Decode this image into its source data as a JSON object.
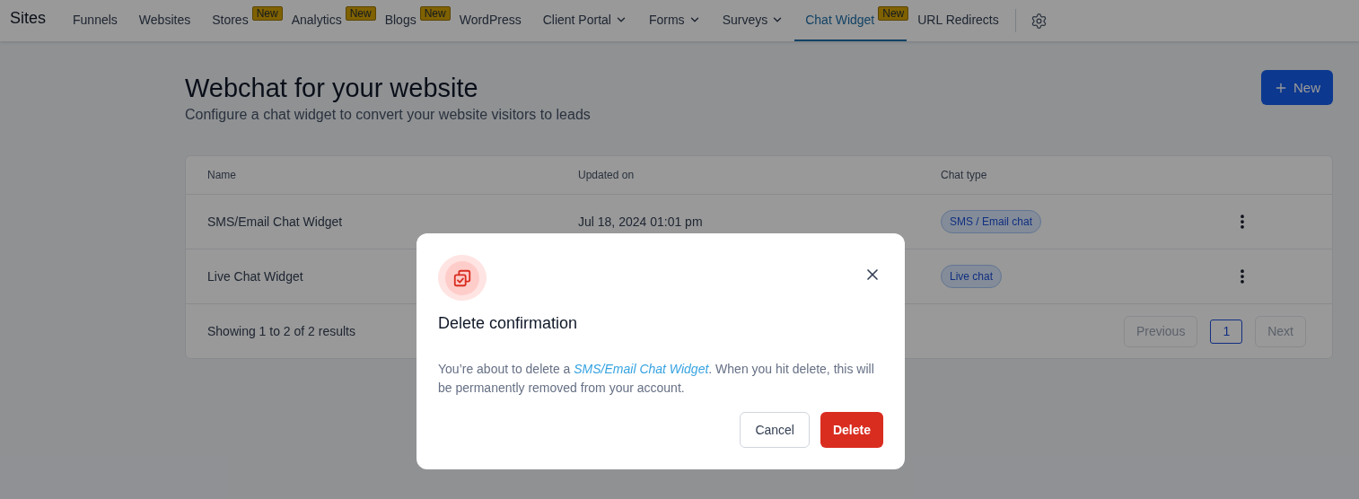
{
  "nav": {
    "brand": "Sites",
    "items": [
      {
        "label": "Funnels",
        "has_menu": false,
        "selected": false
      },
      {
        "label": "Websites",
        "has_menu": false,
        "selected": false
      },
      {
        "label": "Stores",
        "badge": "New",
        "has_menu": false,
        "selected": false
      },
      {
        "label": "Analytics",
        "badge": "New",
        "has_menu": false,
        "selected": false
      },
      {
        "label": "Blogs",
        "badge": "New",
        "has_menu": false,
        "selected": false
      },
      {
        "label": "WordPress",
        "has_menu": false,
        "selected": false
      },
      {
        "label": "Client Portal",
        "has_menu": true,
        "selected": false
      },
      {
        "label": "Forms",
        "has_menu": true,
        "selected": false
      },
      {
        "label": "Surveys",
        "has_menu": true,
        "selected": false
      },
      {
        "label": "Chat Widget",
        "badge": "New",
        "has_menu": false,
        "selected": true
      },
      {
        "label": "URL Redirects",
        "has_menu": false,
        "selected": false
      }
    ]
  },
  "header": {
    "title": "Webchat for your website",
    "subtitle": "Configure a chat widget to convert your website visitors to leads",
    "new_button": "New"
  },
  "table": {
    "columns": [
      "Name",
      "Updated on",
      "Chat type"
    ],
    "rows": [
      {
        "name": "SMS/Email Chat Widget",
        "updated_on": "Jul 18, 2024 01:01 pm",
        "chat_type": "SMS / Email chat"
      },
      {
        "name": "Live Chat Widget",
        "chat_type": "Live chat"
      }
    ],
    "footer": {
      "summary": "Showing 1 to 2 of 2 results",
      "previous": "Previous",
      "pages": [
        {
          "label": "1",
          "selected": true
        }
      ],
      "next": "Next"
    }
  },
  "dialog": {
    "title": "Delete confirmation",
    "message": "You’re about to delete a ",
    "item": "SMS/Email Chat Widget",
    "message_end": ". When you hit delete, this will be permanently removed from your account.",
    "cancel": "Cancel",
    "confirm": "Delete"
  }
}
